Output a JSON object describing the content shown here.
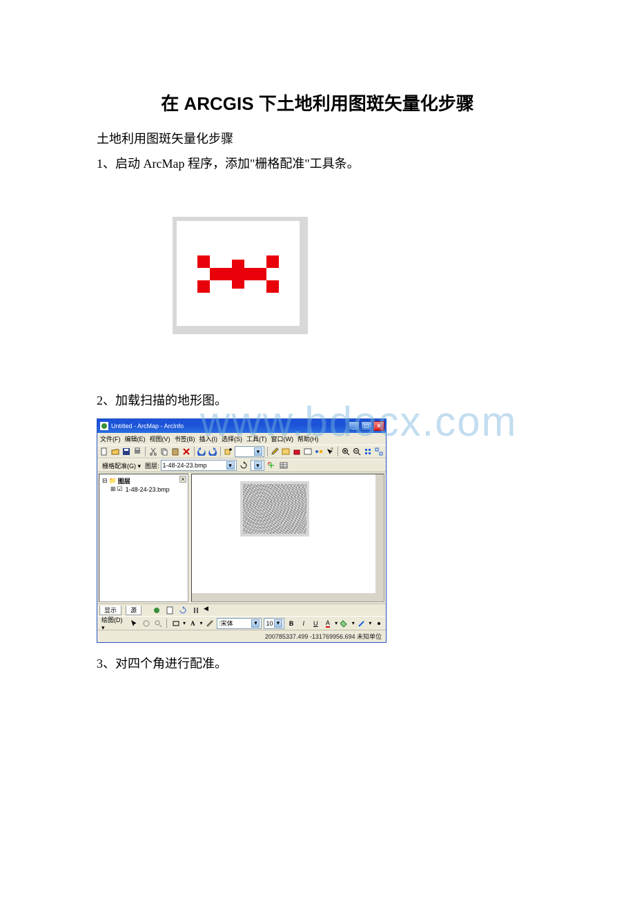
{
  "doc": {
    "title": "在 ARCGIS 下土地利用图斑矢量化步骤",
    "subtitle": "土地利用图斑矢量化步骤",
    "step1": "1、启动 ArcMap 程序，添加\"栅格配准\"工具条。",
    "step2": "2、加载扫描的地形图。",
    "step3": "3、对四个角进行配准。"
  },
  "watermark": "www.bdocx.com",
  "arcmap": {
    "title": "Untitled - ArcMap - ArcInfo",
    "menus": [
      "文件(F)",
      "编辑(E)",
      "视图(V)",
      "书签(B)",
      "插入(I)",
      "选择(S)",
      "工具(T)",
      "窗口(W)",
      "帮助(H)"
    ],
    "georef": {
      "label": "栅格配准(G) ▾",
      "layer_label": "图层:",
      "layer_value": "1-48-24-23.bmp"
    },
    "toc": {
      "root": "图层",
      "item": "1-48-24-23.bmp"
    },
    "tabs": {
      "display": "显示",
      "source": "源"
    },
    "draw": {
      "label": "绘图(D) ▾",
      "font": "宋体",
      "size": "10"
    },
    "status": "200785337.499  -131769956.694 未知单位"
  }
}
